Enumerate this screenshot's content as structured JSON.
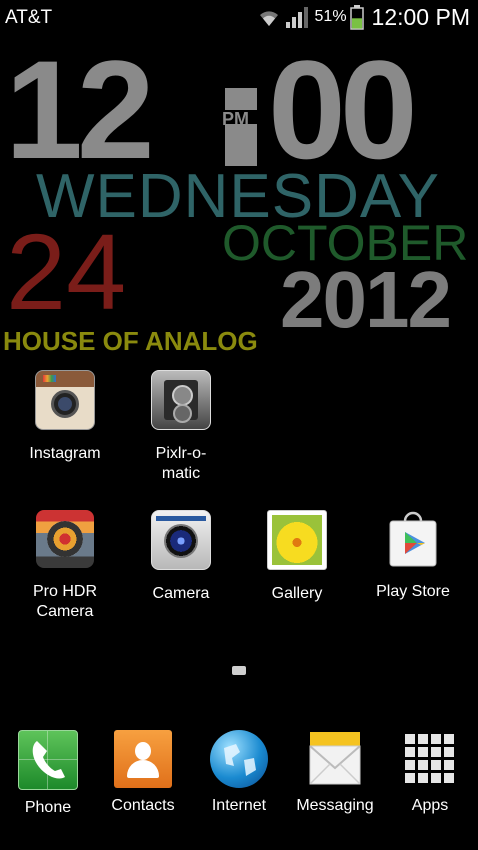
{
  "status_bar": {
    "carrier": "AT&T",
    "battery_percent": "51%",
    "time": "12:00 PM",
    "battery_level": 0.51
  },
  "clock_widget": {
    "hour": "12",
    "minute": "00",
    "ampm": "PM",
    "weekday": "WEDNESDAY",
    "day": "24",
    "month": "OCTOBER",
    "year": "2012",
    "brand": "HOUSE OF ANALOG"
  },
  "home_apps": [
    {
      "label": "Instagram",
      "icon": "instagram-icon"
    },
    {
      "label": "Pixlr-o-matic",
      "icon": "pixlr-icon"
    },
    {
      "label": "Pro HDR Camera",
      "icon": "pro-hdr-camera-icon"
    },
    {
      "label": "Camera",
      "icon": "camera-icon"
    },
    {
      "label": "Gallery",
      "icon": "gallery-icon"
    },
    {
      "label": "Play Store",
      "icon": "play-store-icon"
    }
  ],
  "pixlr_lines": [
    "Pixlr-o-",
    "matic"
  ],
  "hdr_lines": [
    "Pro HDR",
    "Camera"
  ],
  "dock": [
    {
      "label": "Phone",
      "icon": "phone-icon"
    },
    {
      "label": "Contacts",
      "icon": "contacts-icon"
    },
    {
      "label": "Internet",
      "icon": "globe-icon"
    },
    {
      "label": "Messaging",
      "icon": "envelope-icon"
    },
    {
      "label": "Apps",
      "icon": "apps-grid-icon"
    }
  ],
  "colors": {
    "clock_gray": "#8a8a8a",
    "weekday": "#2f6467",
    "day": "#7a1d19",
    "month": "#1f5a2b",
    "brand": "#8a8a0e",
    "battery": "#7ac143"
  }
}
